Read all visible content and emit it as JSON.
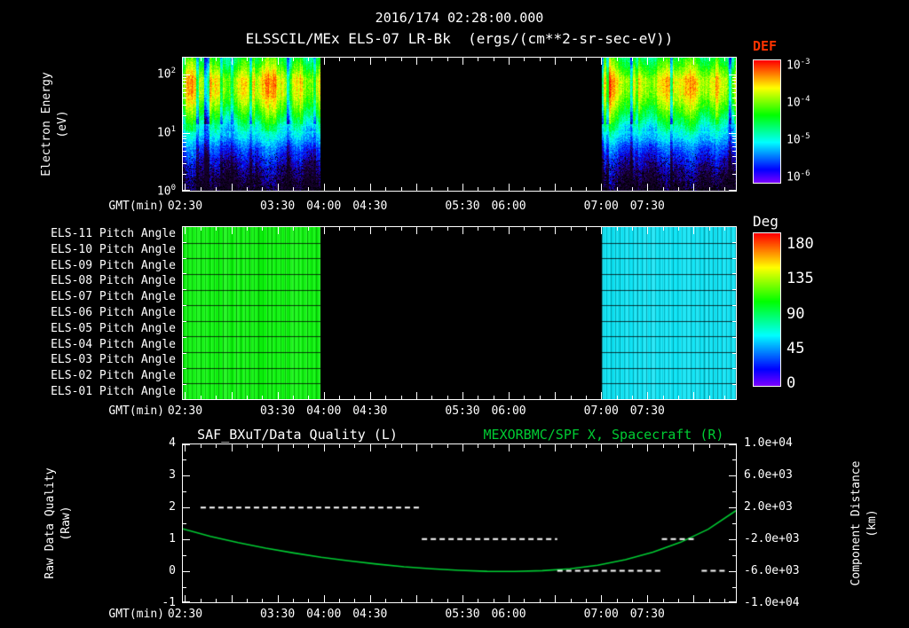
{
  "header": {
    "timestamp_title": "2016/174 02:28:00.000",
    "dataset_title": "ELSSCIL/MEx ELS-07 LR-Bk  (ergs/(cm**2-sr-sec-eV))"
  },
  "colors": {
    "background": "#000000",
    "foreground": "#ffffff",
    "series_green": "#00cc33",
    "def_title_color": "#ff3300"
  },
  "time_axis": {
    "label": "GMT(min)",
    "start_gmt": "02:28",
    "end_gmt": "08:28",
    "span_minutes": 360,
    "first_tick_offset_min": 2,
    "tick_minor_interval_min": 10,
    "tick_major_interval_min": 30,
    "major_tick_labels": [
      {
        "label": "02:30",
        "frac": 0.00556
      },
      {
        "label": "03:30",
        "frac": 0.17222
      },
      {
        "label": "04:00",
        "frac": 0.25556
      },
      {
        "label": "04:30",
        "frac": 0.33889
      },
      {
        "label": "05:30",
        "frac": 0.50556
      },
      {
        "label": "06:00",
        "frac": 0.58889
      },
      {
        "label": "07:00",
        "frac": 0.75556
      },
      {
        "label": "07:30",
        "frac": 0.83889
      }
    ]
  },
  "chart_data": [
    {
      "type": "heatmap",
      "name": "electron_energy_spectrogram",
      "title": "ELSSCIL/MEx ELS-07 LR-Bk",
      "units_label": "(ergs/(cm**2-sr-sec-eV))",
      "ylabel_line1": "Electron Energy",
      "ylabel_line2": "(eV)",
      "y_scale": "log",
      "ylim_ev": [
        1,
        200
      ],
      "y_tick_exponents": [
        2,
        1,
        0
      ],
      "data_intervals": [
        {
          "start_gmt": "02:28",
          "end_gmt": "03:57",
          "x_frac": [
            0.0,
            0.248
          ]
        },
        {
          "start_gmt": "07:02",
          "end_gmt": "08:28",
          "x_frac": [
            0.758,
            1.0
          ]
        }
      ],
      "spectrum_profile": [
        {
          "energy_ev": 200,
          "def_log10": -4.45
        },
        {
          "energy_ev": 130,
          "def_log10": -4.1
        },
        {
          "energy_ev": 85,
          "def_log10": -3.7
        },
        {
          "energy_ev": 50,
          "def_log10": -3.75
        },
        {
          "energy_ev": 33,
          "def_log10": -4.0
        },
        {
          "energy_ev": 19,
          "def_log10": -4.45
        },
        {
          "energy_ev": 13,
          "def_log10": -4.8
        },
        {
          "energy_ev": 8.3,
          "def_log10": -5.1
        },
        {
          "energy_ev": 5.4,
          "def_log10": -5.45
        },
        {
          "energy_ev": 3.2,
          "def_log10": -5.7
        },
        {
          "energy_ev": 1.9,
          "def_log10": -5.9
        },
        {
          "energy_ev": 1.0,
          "def_log10": -6.1
        }
      ],
      "colorbar": {
        "title": "DEF",
        "scale": "log",
        "tick_exponents": [
          -3,
          -4,
          -5,
          -6
        ],
        "range_log10": [
          -3,
          -6
        ]
      }
    },
    {
      "type": "heatmap",
      "name": "pitch_angle_panel",
      "rows": [
        "ELS-11 Pitch Angle",
        "ELS-10 Pitch Angle",
        "ELS-09 Pitch Angle",
        "ELS-08 Pitch Angle",
        "ELS-07 Pitch Angle",
        "ELS-06 Pitch Angle",
        "ELS-05 Pitch Angle",
        "ELS-04 Pitch Angle",
        "ELS-03 Pitch Angle",
        "ELS-02 Pitch Angle",
        "ELS-01 Pitch Angle"
      ],
      "regions": [
        {
          "start_gmt": "02:28",
          "end_gmt": "03:57",
          "x_frac": [
            0.0,
            0.248
          ],
          "pitch_angle_deg": 100
        },
        {
          "start_gmt": "07:02",
          "end_gmt": "08:28",
          "x_frac": [
            0.758,
            1.0
          ],
          "pitch_angle_deg": 57
        }
      ],
      "colorbar": {
        "title": "Deg",
        "ticks": [
          180,
          135,
          90,
          45,
          0
        ],
        "range": [
          0,
          180
        ]
      }
    },
    {
      "type": "line",
      "name": "quality_and_spacecraft_distance",
      "title_left": "SAF_BXuT/Data Quality (L)",
      "title_right": "MEXORBMC/SPF X, Spacecraft (R)",
      "left_axis": {
        "label_line1": "Raw Data Quality",
        "label_line2": "(Raw)",
        "ticks": [
          4,
          3,
          2,
          1,
          0,
          -1
        ],
        "range": [
          -1,
          4
        ]
      },
      "right_axis": {
        "label_line1": "Component Distance",
        "label_line2": "(km)",
        "ticks": [
          "1.0e+04",
          "6.0e+03",
          "2.0e+03",
          "-2.0e+03",
          "-6.0e+03",
          "-1.0e+04"
        ],
        "range": [
          -10000,
          10000
        ]
      },
      "quality_segments": [
        {
          "x_frac": [
            0.032,
            0.432
          ],
          "value": 2
        },
        {
          "x_frac": [
            0.432,
            0.677
          ],
          "value": 1
        },
        {
          "x_frac": [
            0.677,
            0.866
          ],
          "value": 0
        },
        {
          "x_frac": [
            0.866,
            0.93
          ],
          "value": 1
        },
        {
          "x_frac": [
            0.938,
            0.982
          ],
          "value": 0
        }
      ],
      "distance_curve_km": [
        [
          0.0,
          -700
        ],
        [
          0.05,
          -1650
        ],
        [
          0.1,
          -2450
        ],
        [
          0.15,
          -3150
        ],
        [
          0.2,
          -3750
        ],
        [
          0.25,
          -4300
        ],
        [
          0.3,
          -4750
        ],
        [
          0.35,
          -5150
        ],
        [
          0.4,
          -5500
        ],
        [
          0.45,
          -5750
        ],
        [
          0.5,
          -5950
        ],
        [
          0.55,
          -6080
        ],
        [
          0.6,
          -6100
        ],
        [
          0.65,
          -6000
        ],
        [
          0.7,
          -5750
        ],
        [
          0.75,
          -5300
        ],
        [
          0.8,
          -4600
        ],
        [
          0.85,
          -3650
        ],
        [
          0.9,
          -2400
        ],
        [
          0.95,
          -750
        ],
        [
          1.0,
          1600
        ]
      ]
    }
  ]
}
